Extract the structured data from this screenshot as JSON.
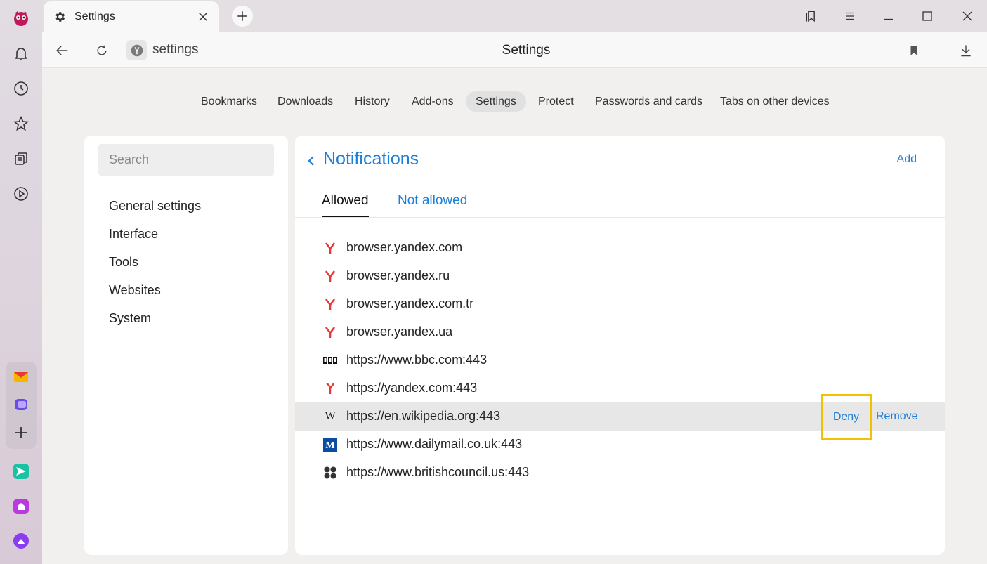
{
  "titlebar": {
    "tab_title": "Settings",
    "icons": [
      "gear-icon",
      "close-icon",
      "plus-icon",
      "bookmarks-panel-icon",
      "menu-icon",
      "minimize-icon",
      "maximize-icon",
      "window-close-icon"
    ]
  },
  "addressbar": {
    "url": "settings",
    "page_title": "Settings"
  },
  "topnav": {
    "items": [
      {
        "label": "Bookmarks"
      },
      {
        "label": "Downloads"
      },
      {
        "label": "History"
      },
      {
        "label": "Add-ons"
      },
      {
        "label": "Settings",
        "active": true
      },
      {
        "label": "Protect"
      },
      {
        "label": "Passwords and cards"
      },
      {
        "label": "Tabs on other devices"
      }
    ]
  },
  "leftpanel": {
    "search_placeholder": "Search",
    "menu": [
      "General settings",
      "Interface",
      "Tools",
      "Websites",
      "System"
    ]
  },
  "main": {
    "heading": "Notifications",
    "add_label": "Add",
    "tabs": [
      {
        "label": "Allowed",
        "active": true
      },
      {
        "label": "Not allowed",
        "active": false
      }
    ],
    "sites": [
      {
        "name": "browser.yandex.com",
        "icon": "yandex-icon"
      },
      {
        "name": "browser.yandex.ru",
        "icon": "yandex-icon"
      },
      {
        "name": "browser.yandex.com.tr",
        "icon": "yandex-icon"
      },
      {
        "name": "browser.yandex.ua",
        "icon": "yandex-icon"
      },
      {
        "name": "https://www.bbc.com:443",
        "icon": "bbc-icon"
      },
      {
        "name": "https://yandex.com:443",
        "icon": "yandex-icon"
      },
      {
        "name": "https://en.wikipedia.org:443",
        "icon": "wikipedia-icon",
        "hovered": true
      },
      {
        "name": "https://www.dailymail.co.uk:443",
        "icon": "dailymail-icon"
      },
      {
        "name": "https://www.britishcouncil.us:443",
        "icon": "britishcouncil-icon"
      }
    ],
    "row_actions": {
      "deny": "Deny",
      "remove": "Remove"
    }
  },
  "colors": {
    "accent": "#1d7ed7",
    "highlight": "#f2c200",
    "yandex_red": "#e53935"
  }
}
